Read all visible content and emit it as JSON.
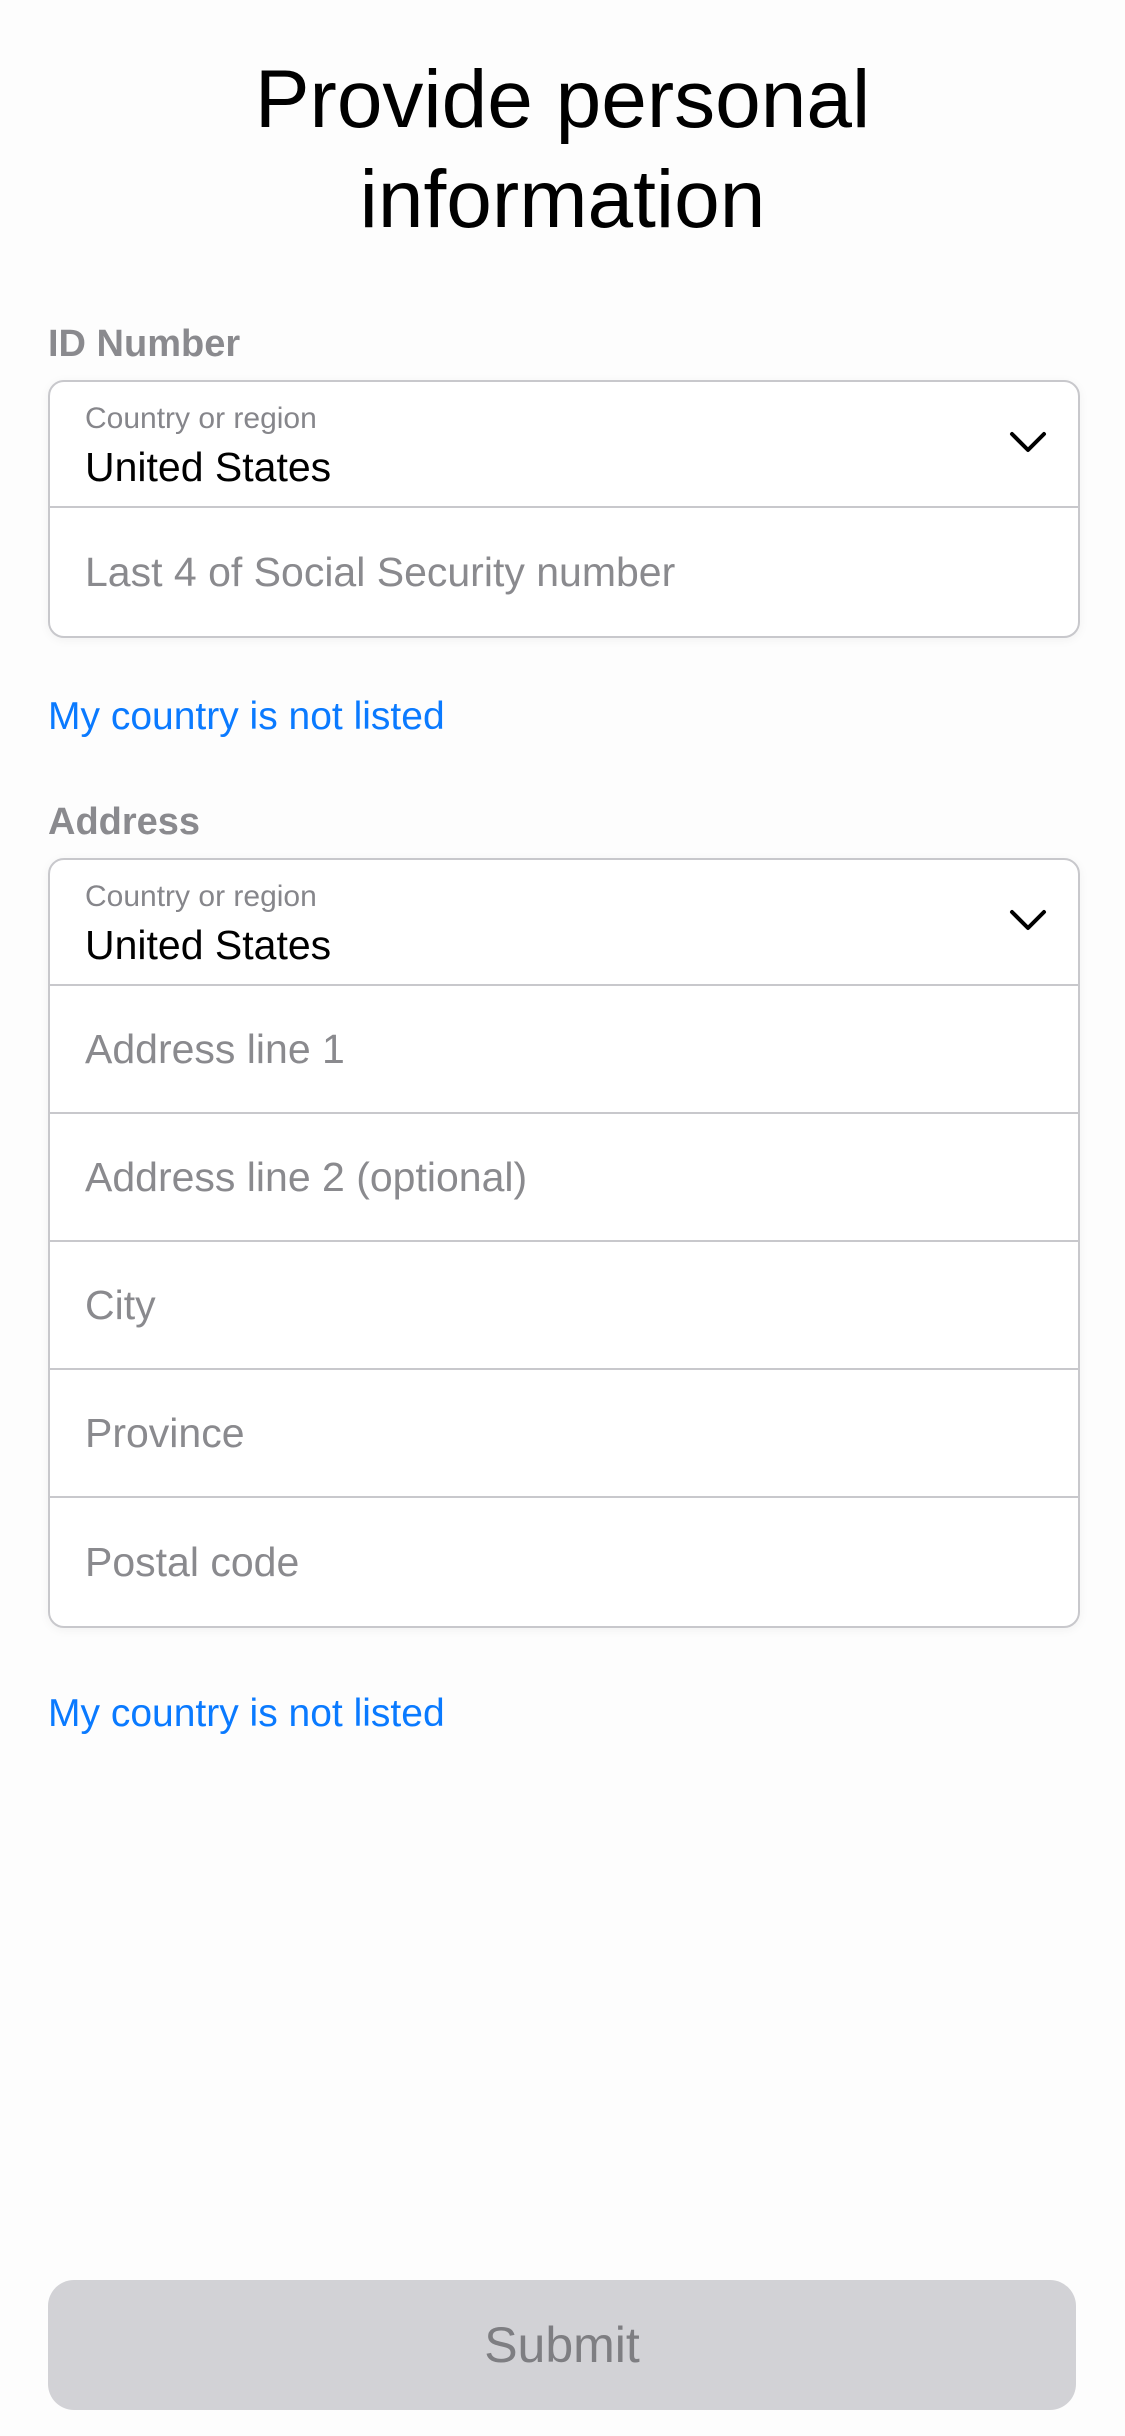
{
  "page": {
    "title": "Provide personal information"
  },
  "id_section": {
    "label": "ID Number",
    "country_select": {
      "caption": "Country or region",
      "value": "United States",
      "icon": "chevron-down-icon"
    },
    "ssn_field": {
      "placeholder": "Last 4 of Social Security number",
      "value": ""
    },
    "not_listed_link": "My country is not listed"
  },
  "address_section": {
    "label": "Address",
    "country_select": {
      "caption": "Country or region",
      "value": "United States",
      "icon": "chevron-down-icon"
    },
    "fields": {
      "address_line_1": {
        "placeholder": "Address line 1",
        "value": ""
      },
      "address_line_2": {
        "placeholder": "Address line 2 (optional)",
        "value": ""
      },
      "city": {
        "placeholder": "City",
        "value": ""
      },
      "province": {
        "placeholder": "Province",
        "value": ""
      },
      "postal_code": {
        "placeholder": "Postal code",
        "value": ""
      }
    },
    "not_listed_link": "My country is not listed"
  },
  "footer": {
    "submit_label": "Submit",
    "submit_enabled": false
  },
  "colors": {
    "link": "#0a7aff",
    "section_label": "#8a8a8e",
    "placeholder": "#8a8a8e",
    "border": "#c8c8cc",
    "submit_bg_disabled": "#d2d2d6",
    "submit_text_disabled": "#7e7e82"
  }
}
